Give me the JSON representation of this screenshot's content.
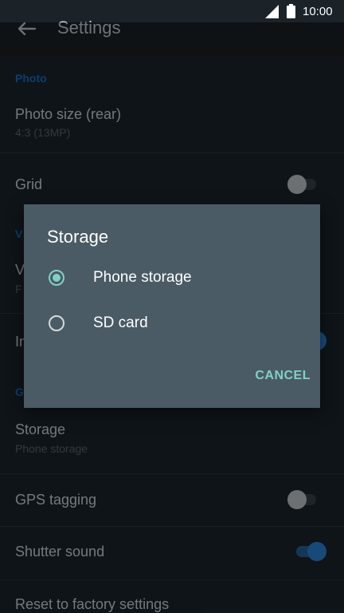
{
  "status_bar": {
    "time": "10:00"
  },
  "toolbar": {
    "title": "Settings"
  },
  "sections": {
    "photo": {
      "header": "Photo"
    },
    "video": {
      "header": "V"
    },
    "general": {
      "header": "G"
    }
  },
  "settings": {
    "photo_size": {
      "label": "Photo size (rear)",
      "value": "4:3 (13MP)"
    },
    "grid": {
      "label": "Grid",
      "enabled": false
    },
    "video_quality": {
      "label": "V",
      "value": "F"
    },
    "image_stabilization": {
      "label": "In",
      "enabled": true
    },
    "storage": {
      "label": "Storage",
      "value": "Phone storage"
    },
    "gps_tagging": {
      "label": "GPS tagging",
      "enabled": false
    },
    "shutter_sound": {
      "label": "Shutter sound",
      "enabled": true
    },
    "reset": {
      "label": "Reset to factory settings"
    }
  },
  "dialog": {
    "title": "Storage",
    "options": [
      {
        "label": "Phone storage",
        "selected": true
      },
      {
        "label": "SD card",
        "selected": false
      }
    ],
    "cancel_label": "CANCEL"
  },
  "colors": {
    "background": "#1d2830",
    "dialog_bg": "#4a5b65",
    "accent_teal": "#7fd1c8",
    "section_header_blue": "#1976d2",
    "switch_on": "#2f8fe8"
  }
}
